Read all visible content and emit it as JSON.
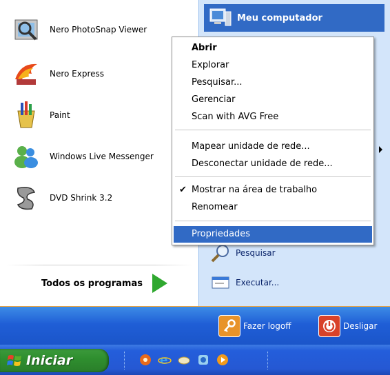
{
  "start_menu": {
    "programs": [
      {
        "label": "Nero PhotoSnap Viewer",
        "icon": "nero-photosnap-icon"
      },
      {
        "label": "Nero Express",
        "icon": "nero-express-icon"
      },
      {
        "label": "Paint",
        "icon": "paint-icon"
      },
      {
        "label": "Windows Live Messenger",
        "icon": "messenger-icon"
      },
      {
        "label": "DVD Shrink 3.2",
        "icon": "dvd-shrink-icon"
      }
    ],
    "all_programs_label": "Todos os programas",
    "right": {
      "my_computer": "Meu computador",
      "search": "Pesquisar",
      "run": "Executar..."
    },
    "logoff_label": "Fazer logoff",
    "shutdown_label": "Desligar"
  },
  "context_menu": {
    "items": [
      {
        "label": "Abrir",
        "bold": true
      },
      {
        "label": "Explorar"
      },
      {
        "label": "Pesquisar..."
      },
      {
        "label": "Gerenciar"
      },
      {
        "label": "Scan with AVG Free"
      },
      {
        "label": "Mapear unidade de rede..."
      },
      {
        "label": "Desconectar unidade de rede..."
      },
      {
        "label": "Mostrar na área de trabalho",
        "checked": true
      },
      {
        "label": "Renomear"
      },
      {
        "label": "Propriedades",
        "selected": true
      }
    ]
  },
  "taskbar": {
    "start_label": "Iniciar",
    "quick_launch_icons": [
      "orange-app-icon",
      "internet-explorer-icon",
      "messenger-icon",
      "media-icon",
      "media-player-icon"
    ]
  },
  "colors": {
    "selection": "#316ac5",
    "start_green": "#2f8f2f",
    "taskbar_blue": "#245edb",
    "right_pane": "#d3e5fa"
  }
}
